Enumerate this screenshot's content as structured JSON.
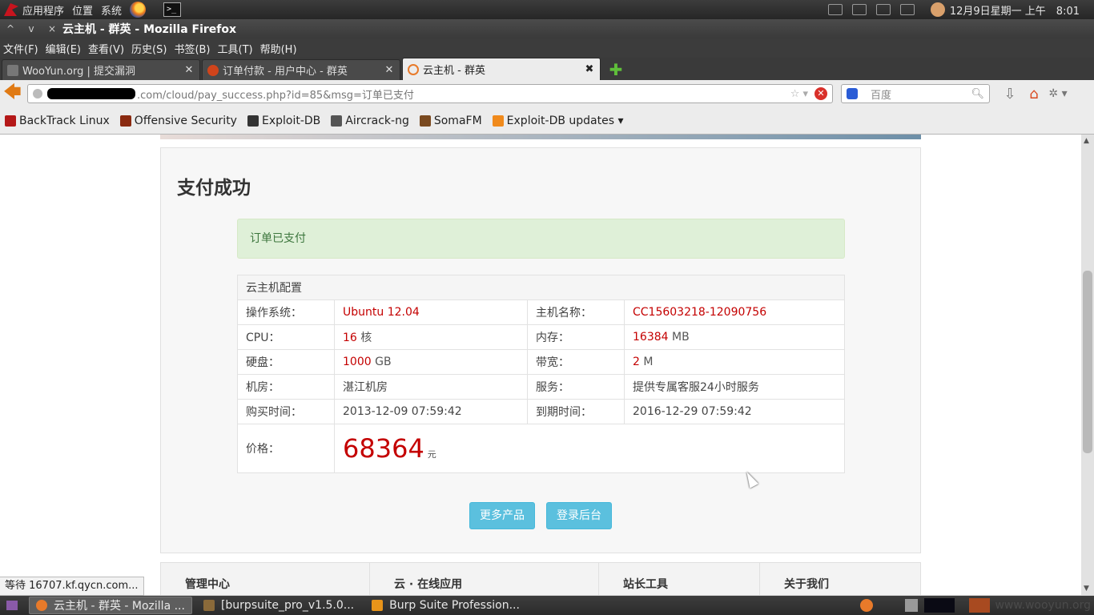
{
  "top_panel": {
    "menus": [
      "应用程序",
      "位置",
      "系统"
    ],
    "terminal_glyph": ">_",
    "clock": "12月9日星期一 上午　8:01"
  },
  "window": {
    "title": "云主机 - 群英 - Mozilla Firefox",
    "controls": [
      "^",
      "v",
      "×"
    ]
  },
  "menubar": [
    "文件(F)",
    "编辑(E)",
    "查看(V)",
    "历史(S)",
    "书签(B)",
    "工具(T)",
    "帮助(H)"
  ],
  "tabs": [
    {
      "label": "WooYun.org | 提交漏洞",
      "active": false,
      "color": "#777777"
    },
    {
      "label": "订单付款 - 用户中心 - 群英",
      "active": false,
      "color": "#d0441b"
    },
    {
      "label": "云主机 - 群英",
      "active": true,
      "color": "#e87a2a"
    }
  ],
  "navbar": {
    "url": ".com/cloud/pay_success.php?id=85&msg=订单已支付",
    "search_placeholder": "百度"
  },
  "bookmarks": [
    {
      "label": "BackTrack Linux",
      "color": "#b41818"
    },
    {
      "label": "Offensive Security",
      "color": "#8a2a10"
    },
    {
      "label": "Exploit-DB",
      "color": "#333333"
    },
    {
      "label": "Aircrack-ng",
      "color": "#555555"
    },
    {
      "label": "SomaFM",
      "color": "#7a4a20"
    },
    {
      "label": "Exploit-DB updates ▾",
      "color": "#f08a1c"
    }
  ],
  "page": {
    "heading": "支付成功",
    "alert": "订单已支付",
    "config_title": "云主机配置",
    "rows": [
      {
        "l1": "操作系统：",
        "v1": "Ubuntu 12.04",
        "u1": "",
        "l2": "主机名称：",
        "v2": "CC15603218-12090756",
        "u2": ""
      },
      {
        "l1": "CPU：",
        "v1": "16",
        "u1": " 核",
        "l2": "内存：",
        "v2": "16384",
        "u2": " MB"
      },
      {
        "l1": "硬盘：",
        "v1": "1000",
        "u1": " GB",
        "l2": "带宽：",
        "v2": "2",
        "u2": " M"
      },
      {
        "l1": "机房：",
        "v1": "湛江机房",
        "u1": "",
        "l2": "服务：",
        "v2": "提供专属客服24小时服务",
        "u2": ""
      },
      {
        "l1": "购买时间：",
        "v1": "2013-12-09 07:59:42",
        "u1": "",
        "l2": "到期时间：",
        "v2": "2016-12-29 07:59:42",
        "u2": ""
      }
    ],
    "price_label": "价格：",
    "price_value": "68364",
    "price_unit": "元",
    "btn_more": "更多产品",
    "btn_login": "登录后台",
    "footer": [
      "管理中心",
      "云 · 在线应用",
      "站长工具",
      "关于我们"
    ]
  },
  "status": "等待 16707.kf.qycn.com...",
  "taskbar": {
    "items": [
      {
        "label": "云主机 - 群英 - Mozilla ...",
        "active": true,
        "color": "#e87a2a"
      },
      {
        "label": "[burpsuite_pro_v1.5.0...",
        "active": false,
        "color": "#8a6a3a"
      },
      {
        "label": "Burp Suite Profession...",
        "active": false,
        "color": "#e8941a"
      }
    ],
    "watermark": "www.wooyun.org"
  },
  "colors": {
    "accent_red": "#c40000",
    "success_bg": "#dff0d8",
    "button": "#5bc0de"
  }
}
